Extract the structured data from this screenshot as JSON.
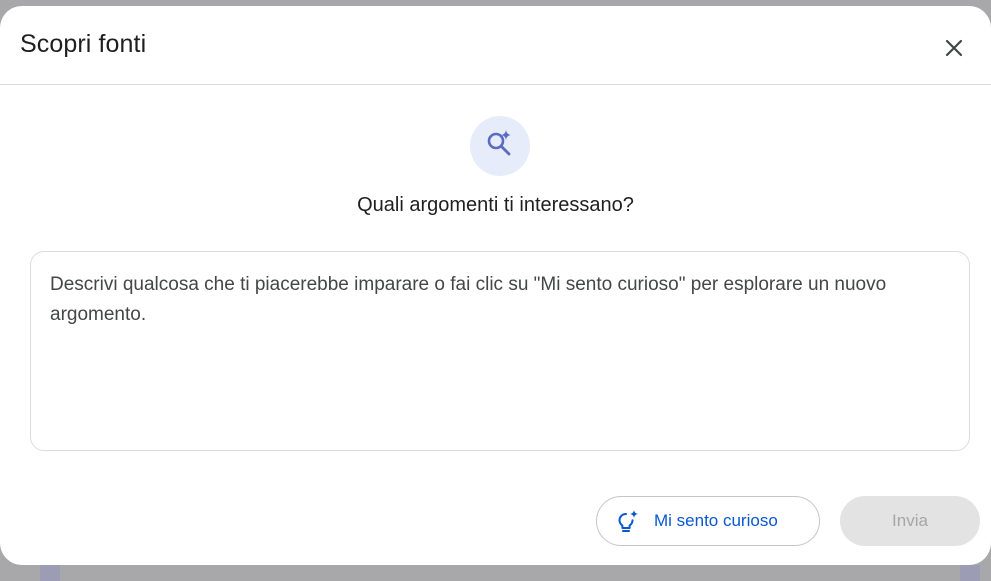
{
  "dialog": {
    "title": "Scopri fonti",
    "close_icon": "close-icon"
  },
  "hero": {
    "icon": "search-sparkle-icon",
    "question": "Quali argomenti ti interessano?"
  },
  "prompt": {
    "placeholder": "Descrivi qualcosa che ti piacerebbe imparare o fai clic su \"Mi sento curioso\" per esplorare un nuovo argomento.",
    "value": ""
  },
  "actions": {
    "curious_icon": "lightbulb-sparkle-icon",
    "curious_label": "Mi sento curioso",
    "send_label": "Invia",
    "send_enabled": false
  },
  "colors": {
    "accent": "#0b57d0",
    "badge_bg": "#e7ecfa",
    "icon_accent": "#5b6bbf",
    "disabled_bg": "#e3e3e3",
    "disabled_text": "#a6a6a6"
  }
}
